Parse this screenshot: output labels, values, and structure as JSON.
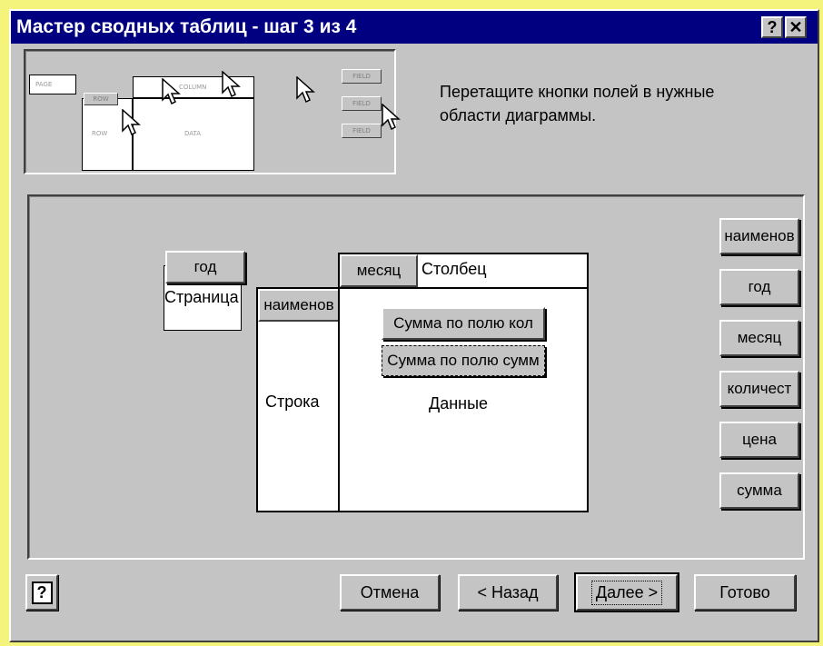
{
  "window": {
    "title": "Мастер сводных таблиц - шаг 3 из 4",
    "help_glyph": "?",
    "close_glyph": "✕"
  },
  "preview": {
    "labels": [
      "PAGE",
      "COLUMN",
      "ROW",
      "ROW",
      "DATA",
      "FIELD",
      "FIELD",
      "FIELD"
    ]
  },
  "instruction": {
    "line1": "Перетащите кнопки полей в нужные",
    "line2": "области диаграммы."
  },
  "layout": {
    "page_field": "год",
    "page_zone_label": "Страница",
    "row_field": "наименов",
    "row_zone_label": "Строка",
    "column_field": "месяц",
    "column_zone_label": "Столбец",
    "data_fields": [
      "Сумма по полю кол",
      "Сумма по полю сумм"
    ],
    "data_zone_label": "Данные"
  },
  "available_fields": [
    "наименов",
    "год",
    "месяц",
    "количест",
    "цена",
    "сумма"
  ],
  "footer": {
    "help_icon": "?",
    "cancel": "Отмена",
    "back": "< Назад",
    "next": "Далее >",
    "finish": "Готово"
  }
}
